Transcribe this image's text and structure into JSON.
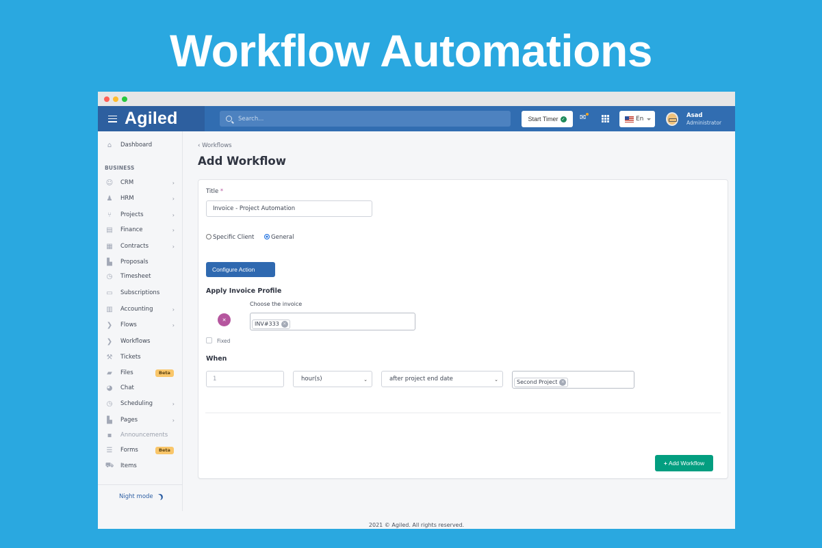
{
  "hero": {
    "title": "Workflow Automations"
  },
  "app": {
    "logo": "Agiled",
    "search_placeholder": "Search...",
    "start_timer_label": "Start Timer",
    "language": "En",
    "user": {
      "name": "Asad",
      "role": "Administrator"
    }
  },
  "sidebar": {
    "dashboard": "Dashboard",
    "section_label": "BUSINESS",
    "items": [
      {
        "label": "CRM",
        "icon": "user-icon",
        "chevron": true
      },
      {
        "label": "HRM",
        "icon": "users-icon",
        "chevron": true
      },
      {
        "label": "Projects",
        "icon": "branch-icon",
        "chevron": true
      },
      {
        "label": "Finance",
        "icon": "invoice-icon",
        "chevron": true
      },
      {
        "label": "Contracts",
        "icon": "contract-icon",
        "chevron": true
      },
      {
        "label": "Proposals",
        "icon": "document-icon",
        "chevron": false
      },
      {
        "label": "Timesheet",
        "icon": "clock-icon",
        "chevron": false
      },
      {
        "label": "Subscriptions",
        "icon": "credit-card-icon",
        "chevron": false
      },
      {
        "label": "Accounting",
        "icon": "bar-chart-icon",
        "chevron": true
      },
      {
        "label": "Flows",
        "icon": "chevron-right-icon",
        "chevron": true
      },
      {
        "label": "Workflows",
        "icon": "chevron-right-icon",
        "chevron": false
      },
      {
        "label": "Tickets",
        "icon": "wrench-icon",
        "chevron": false
      },
      {
        "label": "Files",
        "icon": "folder-icon",
        "chevron": false,
        "badge": "Beta"
      },
      {
        "label": "Chat",
        "icon": "chat-icon",
        "chevron": false
      },
      {
        "label": "Scheduling",
        "icon": "clock-icon",
        "chevron": true
      },
      {
        "label": "Pages",
        "icon": "page-icon",
        "chevron": true
      },
      {
        "label": "Announcements",
        "icon": "note-icon",
        "chevron": false,
        "muted": true
      },
      {
        "label": "Forms",
        "icon": "list-icon",
        "chevron": false,
        "badge": "Beta"
      },
      {
        "label": "Items",
        "icon": "cart-icon",
        "chevron": false
      }
    ],
    "night_mode": "Night mode"
  },
  "main": {
    "breadcrumb": "Workflows",
    "page_title": "Add Workflow",
    "form": {
      "title_label": "Title",
      "title_required": "*",
      "title_value": "Invoice - Project Automation",
      "radio_specific_client": "Specific Client",
      "radio_general": "General",
      "radio_selected": "General",
      "configure_action_label": "Configure Action",
      "apply_invoice_profile": "Apply Invoice Profile",
      "choose_invoice_label": "Choose the invoice",
      "invoice_tag": "INV#333",
      "fixed_label": "Fixed",
      "fixed_checked": false,
      "when_label": "When",
      "when_amount": "1",
      "when_unit": "hour(s)",
      "when_trigger": "after project end date",
      "project_tag": "Second Project",
      "add_workflow_label": "Add Workflow"
    }
  },
  "footer": {
    "text": "2021 © Agiled. All rights reserved."
  },
  "colors": {
    "background": "#2aa8e0",
    "topbar": "#316db1",
    "primary_button": "#2f69b0",
    "success_button": "#039e80",
    "beta_badge": "#f9c66a",
    "remove_circle": "#b5569e"
  }
}
